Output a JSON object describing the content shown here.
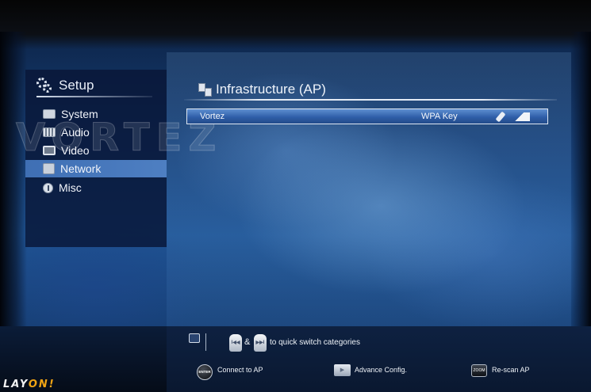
{
  "sidebar": {
    "title": "Setup",
    "items": [
      {
        "label": "System",
        "icon": "system-icon"
      },
      {
        "label": "Audio",
        "icon": "audio-icon"
      },
      {
        "label": "Video",
        "icon": "video-icon"
      },
      {
        "label": "Network",
        "icon": "network-icon",
        "selected": true
      },
      {
        "label": "Misc",
        "icon": "misc-icon"
      }
    ]
  },
  "watermark": "VORTEZ",
  "main": {
    "title": "Infrastructure (AP)",
    "networks": [
      {
        "ssid": "Vortez",
        "security": "WPA Key"
      }
    ]
  },
  "footer": {
    "skip_prev_label": "I◀◀",
    "amp": "&",
    "skip_next_label": "▶▶I",
    "switch_hint": "to quick switch categories",
    "enter_key": "ENTER",
    "connect_label": "Connect to AP",
    "play_key": "▶",
    "advance_label": "Advance Config.",
    "zoom_key": "ZOOM",
    "rescan_label": "Re-scan AP"
  },
  "brand": {
    "logo_left": "LAY",
    "logo_right": "ON!",
    "accent": "#f0a414"
  }
}
